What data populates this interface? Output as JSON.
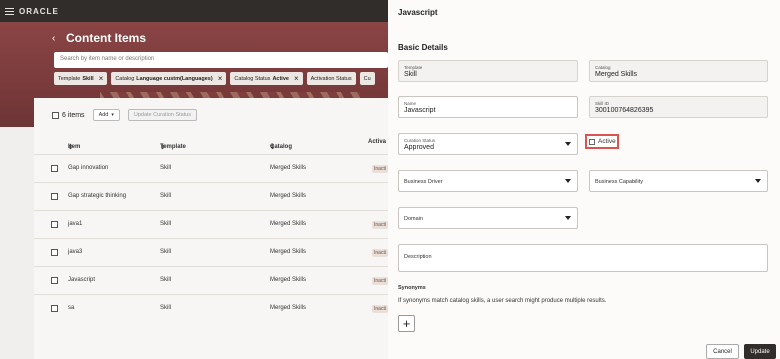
{
  "app": {
    "logo": "ORACLE"
  },
  "page": {
    "title": "Content Items",
    "search_placeholder": "Search by item name or description"
  },
  "filters": [
    {
      "label": "Template",
      "value": "Skill"
    },
    {
      "label": "Catalog",
      "value": "Language custm(Languages)"
    },
    {
      "label": "Catalog Status",
      "value": "Active"
    },
    {
      "label": "Activation Status",
      "value": ""
    },
    {
      "label": "Cu",
      "value": ""
    }
  ],
  "toolbar": {
    "count_label": "6 items",
    "add_label": "Add",
    "update_status_label": "Update Curation Status"
  },
  "table": {
    "columns": [
      "Item",
      "Template",
      "Catalog",
      "Activa"
    ],
    "rows": [
      {
        "item": "Gap innovation",
        "template": "Skill",
        "catalog": "Merged Skills",
        "status": "Inacti"
      },
      {
        "item": "Gap strategic thinking",
        "template": "Skill",
        "catalog": "Merged Skills",
        "status": ""
      },
      {
        "item": "java1",
        "template": "Skill",
        "catalog": "Merged Skills",
        "status": "Inacti"
      },
      {
        "item": "java3",
        "template": "Skill",
        "catalog": "Merged Skills",
        "status": "Inacti"
      },
      {
        "item": "Javascript",
        "template": "Skill",
        "catalog": "Merged Skills",
        "status": "Inacti"
      },
      {
        "item": "sa",
        "template": "Skill",
        "catalog": "Merged Skills",
        "status": "Inacti"
      }
    ]
  },
  "panel": {
    "title": "Javascript",
    "section": "Basic Details",
    "template": {
      "label": "Template",
      "value": "Skill"
    },
    "catalog": {
      "label": "Catalog",
      "value": "Merged Skills"
    },
    "name": {
      "label": "Name",
      "value": "Javascript"
    },
    "skill_id": {
      "label": "Skill ID",
      "value": "300100764826395"
    },
    "curation_status": {
      "label": "Curation Status",
      "value": "Approved"
    },
    "active_label": "Active",
    "business_driver": "Business Driver",
    "business_capability": "Business Capability",
    "domain": "Domain",
    "description": "Description",
    "synonyms_title": "Synonyms",
    "synonyms_help": "If synonyms match catalog skills, a user search might produce multiple results.",
    "add_synonym": "+",
    "cancel_label": "Cancel",
    "update_label": "Update"
  },
  "colors": {
    "header": "#312d2a",
    "hero": "#7a3a3b",
    "highlight": "#d9534f"
  }
}
